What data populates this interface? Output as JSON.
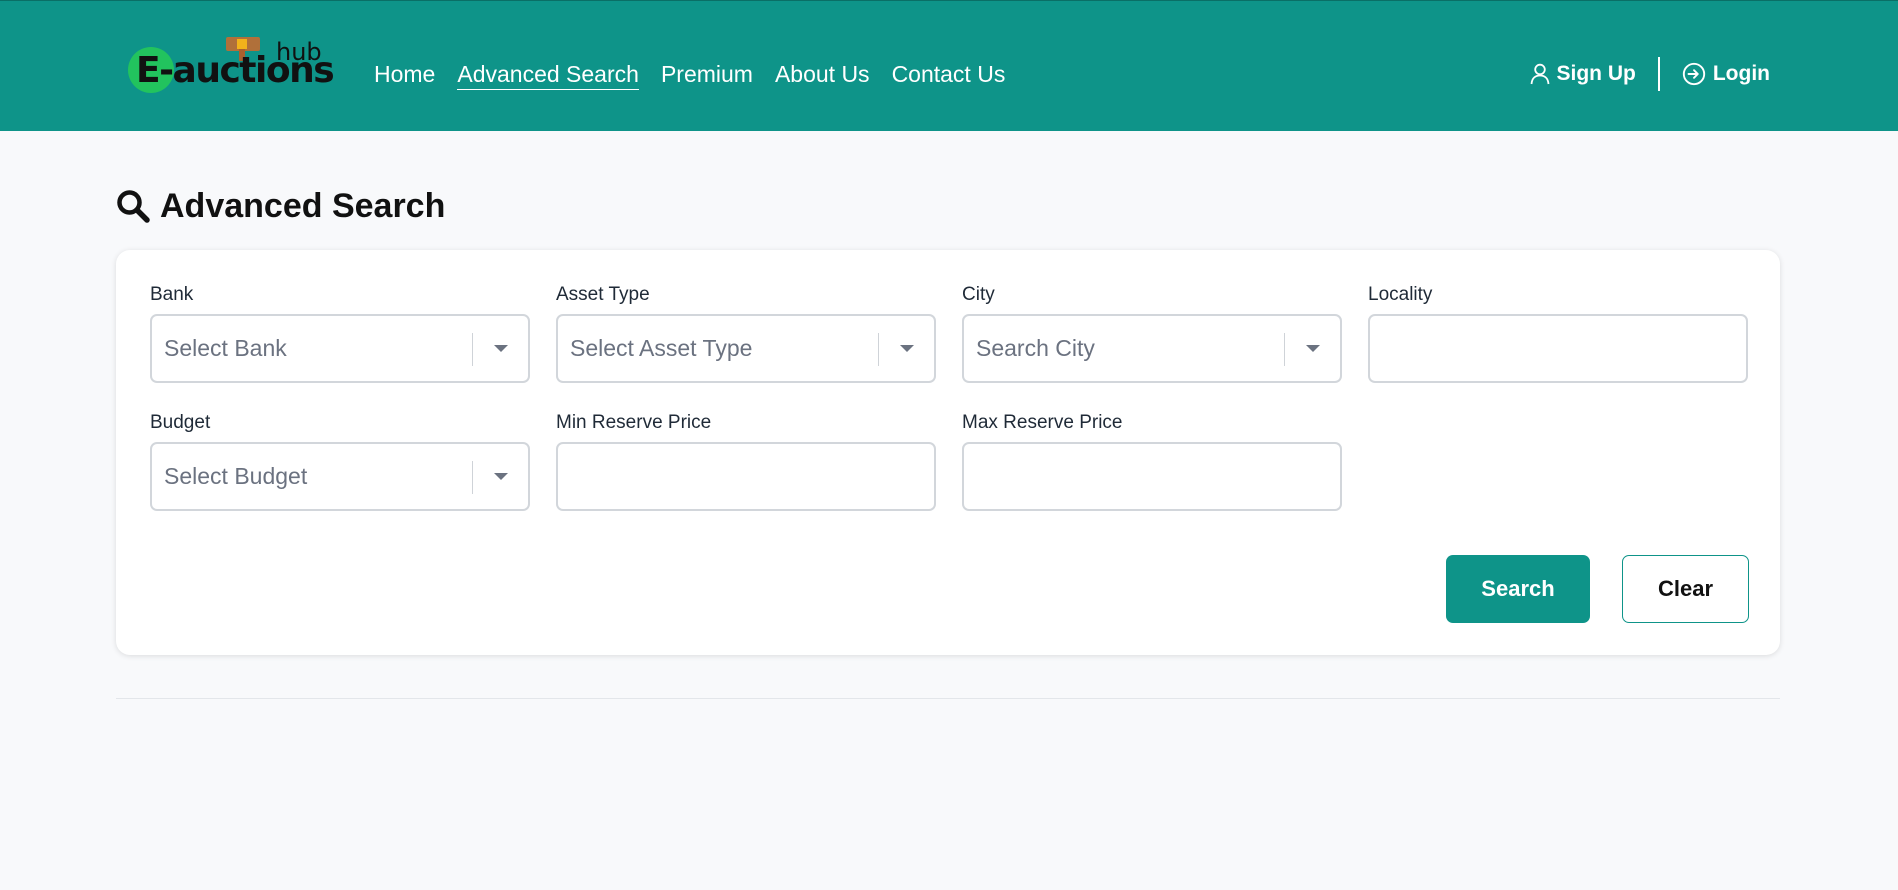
{
  "brand": {
    "logo_text": "E-auctions",
    "logo_sub": "hub",
    "colors": {
      "header": "#0e9489",
      "logo_circle": "#22c35e"
    }
  },
  "nav": {
    "items": [
      {
        "label": "Home",
        "active": false
      },
      {
        "label": "Advanced Search",
        "active": true
      },
      {
        "label": "Premium",
        "active": false
      },
      {
        "label": "About Us",
        "active": false
      },
      {
        "label": "Contact Us",
        "active": false
      }
    ]
  },
  "auth": {
    "signup_label": "Sign Up",
    "signup_icon": "user-icon",
    "login_label": "Login",
    "login_icon": "login-icon"
  },
  "page": {
    "title": "Advanced Search",
    "title_icon": "search-icon"
  },
  "form": {
    "bank": {
      "label": "Bank",
      "placeholder": "Select Bank"
    },
    "asset_type": {
      "label": "Asset Type",
      "placeholder": "Select Asset Type"
    },
    "city": {
      "label": "City",
      "placeholder": "Search City"
    },
    "locality": {
      "label": "Locality",
      "value": ""
    },
    "budget": {
      "label": "Budget",
      "placeholder": "Select Budget"
    },
    "min_reserve": {
      "label": "Min Reserve Price",
      "value": ""
    },
    "max_reserve": {
      "label": "Max Reserve Price",
      "value": ""
    },
    "search_label": "Search",
    "clear_label": "Clear"
  }
}
